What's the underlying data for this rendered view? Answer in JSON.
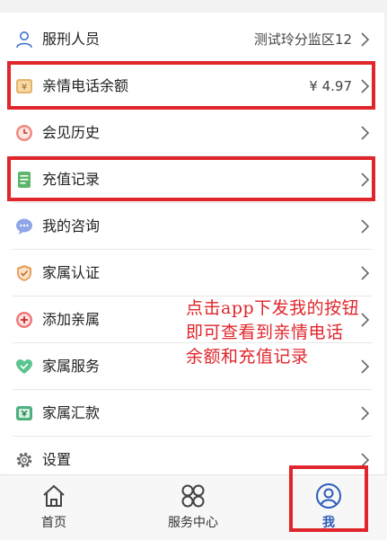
{
  "menu": [
    {
      "id": "prisoner",
      "label": "服刑人员",
      "value": "测试玲分监区12",
      "icon": "person-icon"
    },
    {
      "id": "balance",
      "label": "亲情电话余额",
      "value": "¥ 4.97",
      "icon": "yen-wallet-icon"
    },
    {
      "id": "visit-history",
      "label": "会见历史",
      "value": "",
      "icon": "clock-icon"
    },
    {
      "id": "recharge-records",
      "label": "充值记录",
      "value": "",
      "icon": "document-icon"
    },
    {
      "id": "my-consult",
      "label": "我的咨询",
      "value": "",
      "icon": "chat-bubble-icon"
    },
    {
      "id": "family-auth",
      "label": "家属认证",
      "value": "",
      "icon": "shield-icon"
    },
    {
      "id": "add-family",
      "label": "添加亲属",
      "value": "",
      "icon": "plus-circle-icon"
    },
    {
      "id": "family-service",
      "label": "家属服务",
      "value": "",
      "icon": "heart-icon"
    },
    {
      "id": "family-remit",
      "label": "家属汇款",
      "value": "",
      "icon": "remittance-icon"
    },
    {
      "id": "settings",
      "label": "设置",
      "value": "",
      "icon": "gear-icon"
    }
  ],
  "annotation": {
    "lines": [
      "点击app下发我的按钮",
      "即可查看到亲情电话",
      "余额和充值记录"
    ],
    "color": "#e0252b"
  },
  "tabbar": {
    "tabs": [
      {
        "label": "首页",
        "icon": "home-icon"
      },
      {
        "label": "服务中心",
        "icon": "grid-icon"
      },
      {
        "label": "我",
        "icon": "profile-icon"
      }
    ],
    "active_color": "#2b5bb8"
  }
}
